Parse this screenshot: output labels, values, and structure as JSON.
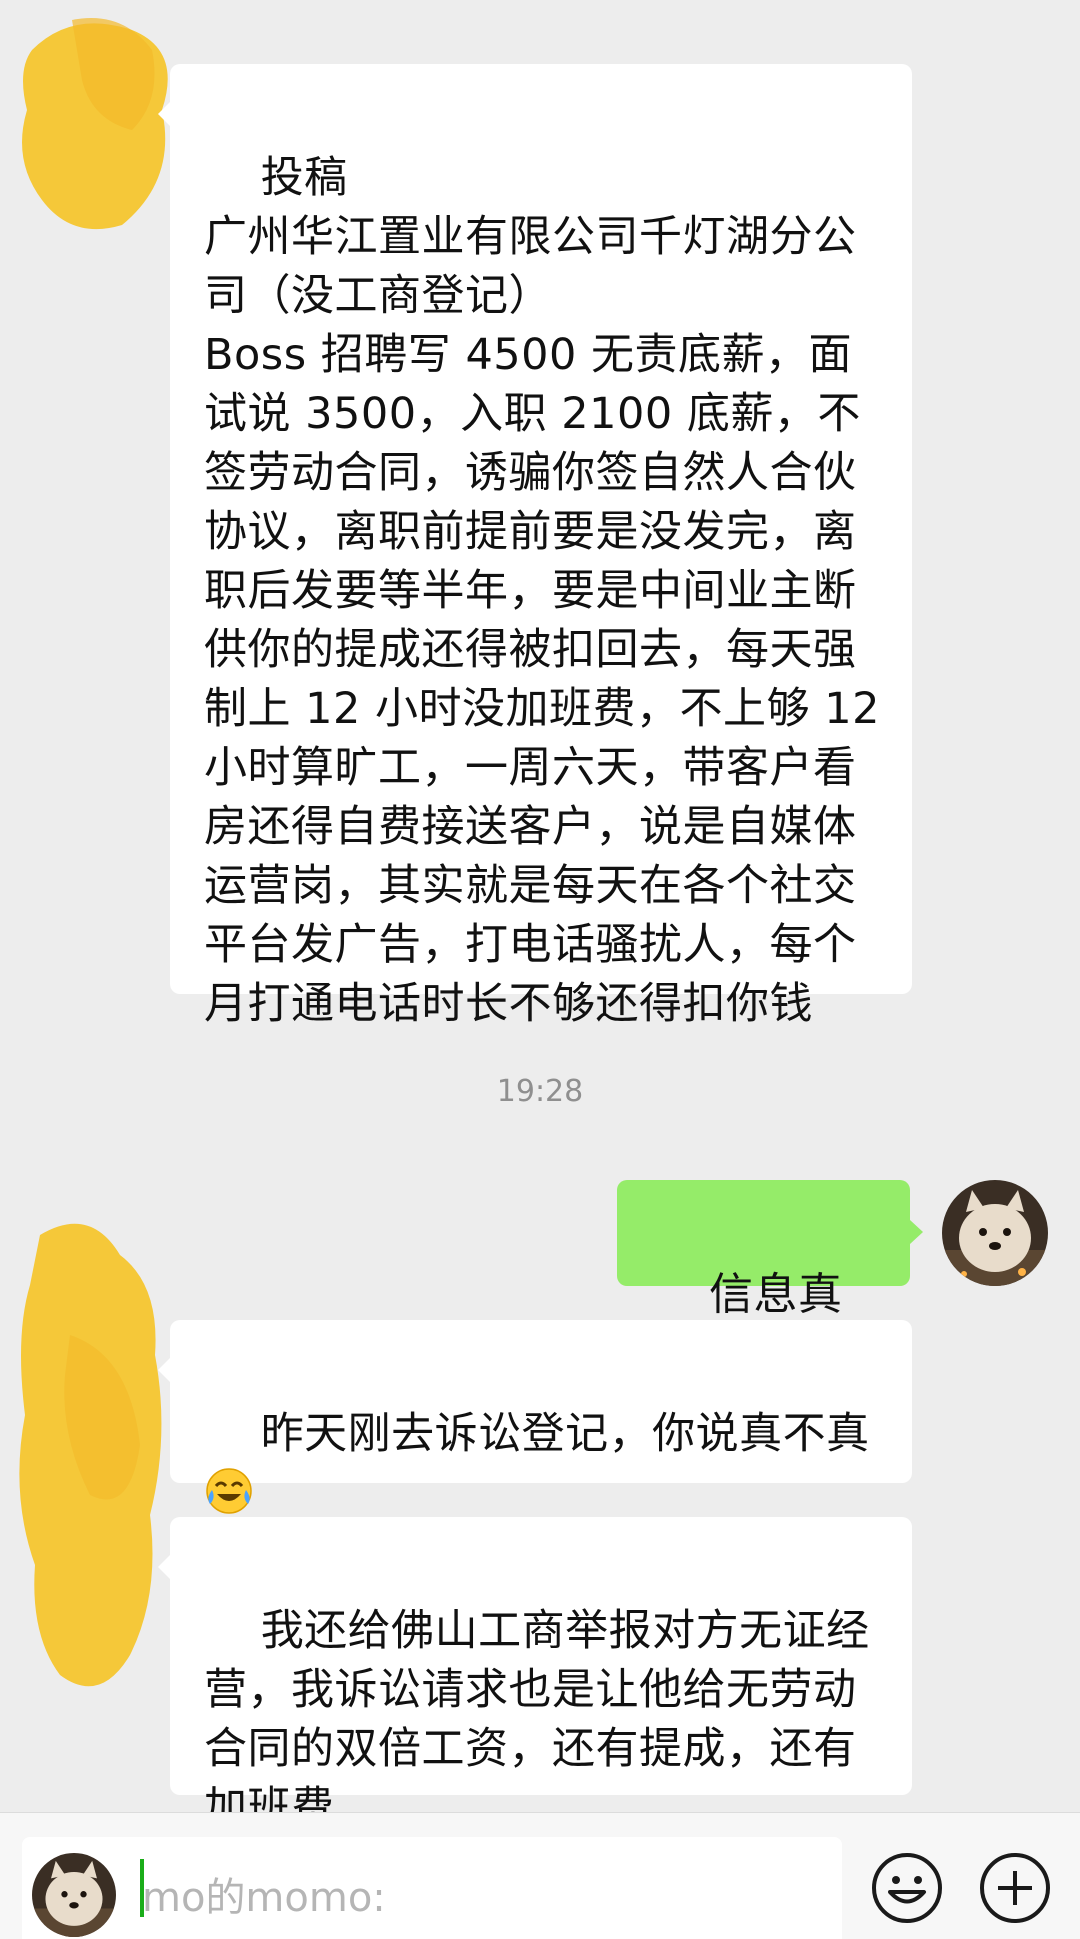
{
  "messages": [
    {
      "side": "left",
      "text": "投稿\n广州华江置业有限公司千灯湖分公司（没工商登记）\nBoss 招聘写 4500 无责底薪，面试说 3500，入职 2100 底薪，不签劳动合同，诱骗你签自然人合伙协议，离职前提前要是没发完，离职后发要等半年，要是中间业主断供你的提成还得被扣回去，每天强制上 12 小时没加班费，不上够 12 小时算旷工，一周六天，带客户看房还得自费接送客户，说是自媒体运营岗，其实就是每天在各个社交平台发广告，打电话骚扰人，每个月打通电话时长不够还得扣你钱"
    },
    {
      "side": "right",
      "text": "信息真实吗"
    },
    {
      "side": "left",
      "text": "昨天刚去诉讼登记，你说真不真"
    },
    {
      "side": "left",
      "text": "我还给佛山工商举报对方无证经营，我诉讼请求也是让他给无劳动合同的双倍工资，还有提成，还有加班费"
    }
  ],
  "timestamp": "19:28",
  "input": {
    "placeholder": "mo的momo:"
  },
  "icons": {
    "emoji_button": "smiley-face-icon",
    "more_button": "plus-circle-icon",
    "crying_laughing": "face-with-tears-of-joy-emoji"
  },
  "colors": {
    "background": "#ededed",
    "bubble_left": "#ffffff",
    "bubble_right": "#95ec69",
    "redaction": "#f6c62f"
  }
}
